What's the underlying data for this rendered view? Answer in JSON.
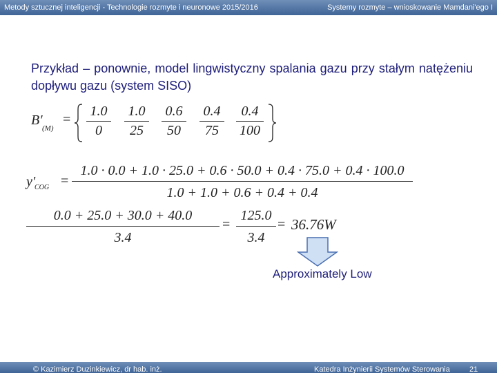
{
  "header": {
    "left": "Metody sztucznej inteligencji - Technologie rozmyte i neuronowe 2015/2016",
    "right": "Systemy rozmyte – wnioskowanie Mamdani'ego I"
  },
  "slide": {
    "paragraph": "Przykład – ponownie, model lingwistyczny spalania gazu przy stałym natężeniu dopływu gazu (system SISO)"
  },
  "set_def": {
    "label": "B′",
    "subscript": "(M)",
    "equals": "=",
    "fractions": [
      {
        "num": "1.0",
        "den": "0"
      },
      {
        "num": "1.0",
        "den": "25"
      },
      {
        "num": "0.6",
        "den": "50"
      },
      {
        "num": "0.4",
        "den": "75"
      },
      {
        "num": "0.4",
        "den": "100"
      }
    ]
  },
  "cog": {
    "label": "y′",
    "subscript": "COG",
    "equals": "=",
    "numerator": "1.0 · 0.0 + 1.0 · 25.0 + 0.6 · 50.0 + 0.4 · 75.0 + 0.4 · 100.0",
    "denominator": "1.0 + 1.0 + 0.6 + 0.4 + 0.4"
  },
  "second_line": {
    "frac1_num": "0.0 + 25.0 + 30.0 + 40.0",
    "frac1_den": "3.4",
    "equals1": "=",
    "frac2_num": "125.0",
    "frac2_den": "3.4",
    "equals2": "=",
    "result": "36.76W"
  },
  "result_label": "Approximately Low",
  "footer": {
    "left": "© Kazimierz Duzinkiewicz, dr hab. inż.",
    "right": "Katedra Inżynierii Systemów Sterowania",
    "page": "21"
  },
  "colors": {
    "header_bg": "#4f72a3",
    "text": "#1d1d7a",
    "arrow_fill": "#cfe0f5",
    "arrow_stroke": "#4a6fb0"
  }
}
